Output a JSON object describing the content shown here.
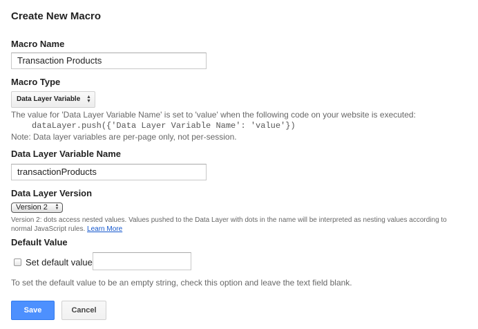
{
  "title": "Create New Macro",
  "macro_name": {
    "label": "Macro Name",
    "value": "Transaction Products"
  },
  "macro_type": {
    "label": "Macro Type",
    "selected": "Data Layer Variable",
    "help_line1": "The value for 'Data Layer Variable Name' is set to 'value' when the following code on your website is executed:",
    "code": "dataLayer.push({'Data Layer Variable Name': 'value'})",
    "note": "Note: Data layer variables are per-page only, not per-session."
  },
  "dlv_name": {
    "label": "Data Layer Variable Name",
    "value": "transactionProducts"
  },
  "dl_version": {
    "label": "Data Layer Version",
    "selected": "Version 2",
    "help_line1": "Version 2: dots access nested values. Values pushed to the Data Layer with dots in the name will be interpreted as nesting values according to",
    "help_line2": "normal JavaScript rules.",
    "learn_more": "Learn More"
  },
  "default_value": {
    "label": "Default Value",
    "checkbox_label": "Set default value:",
    "checked": false,
    "value": "",
    "help": "To set the default value to be an empty string, check this option and leave the text field blank."
  },
  "buttons": {
    "save": "Save",
    "cancel": "Cancel"
  },
  "colors": {
    "primary": "#4d90fe",
    "link": "#1155cc",
    "help_text": "#666666"
  }
}
